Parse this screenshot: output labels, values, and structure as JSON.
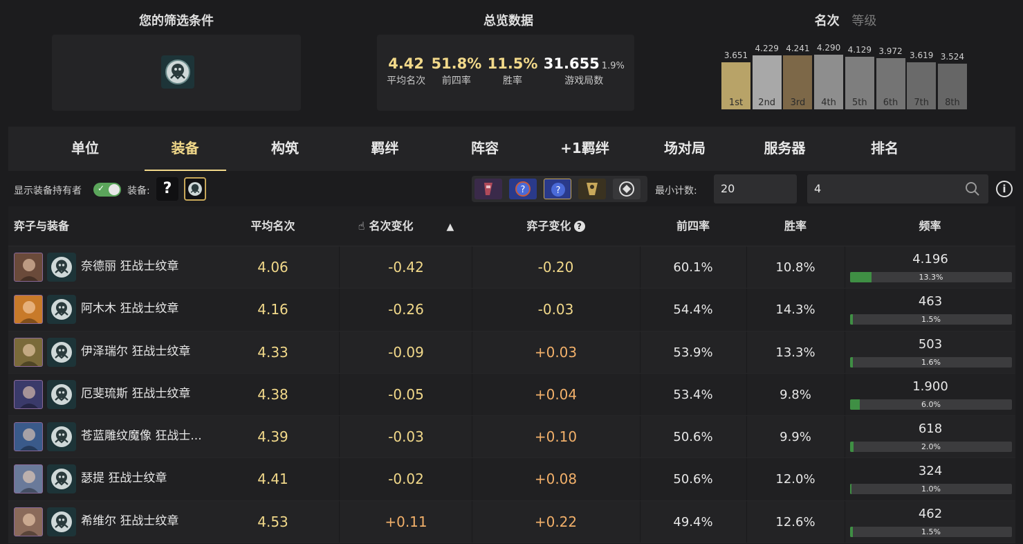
{
  "filter_panel": {
    "title": "您的筛选条件",
    "icon": "berserker-emblem-icon"
  },
  "overview": {
    "title": "总览数据",
    "stats": [
      {
        "value": "4.42",
        "sub": "",
        "label": "平均名次"
      },
      {
        "value": "51.8%",
        "sub": "",
        "label": "前四率"
      },
      {
        "value": "11.5%",
        "sub": "",
        "label": "胜率"
      },
      {
        "value": "31.655",
        "sub": "1.9%",
        "label": "游戏局数"
      }
    ]
  },
  "rank_panel": {
    "title_active": "名次",
    "title_inactive": "等级",
    "bars": [
      {
        "label": "1st",
        "value": "3.651",
        "num": 3.651,
        "color": "#b8a368"
      },
      {
        "label": "2nd",
        "value": "4.229",
        "num": 4.229,
        "color": "#a8a8a8"
      },
      {
        "label": "3rd",
        "value": "4.241",
        "num": 4.241,
        "color": "#7d6848"
      },
      {
        "label": "4th",
        "value": "4.290",
        "num": 4.29,
        "color": "#8e8e8e"
      },
      {
        "label": "5th",
        "value": "4.129",
        "num": 4.129,
        "color": "#7e7e7e"
      },
      {
        "label": "6th",
        "value": "3.972",
        "num": 3.972,
        "color": "#747474"
      },
      {
        "label": "7th",
        "value": "3.619",
        "num": 3.619,
        "color": "#6a6a6a"
      },
      {
        "label": "8th",
        "value": "3.524",
        "num": 3.524,
        "color": "#666666"
      }
    ]
  },
  "tabs": [
    "单位",
    "装备",
    "构筑",
    "羁绊",
    "阵容",
    "+1羁绊",
    "场对局",
    "服务器",
    "排名"
  ],
  "active_tab": 1,
  "filter_row": {
    "show_holder_label": "显示装备持有者",
    "equip_label": "装备:",
    "unknown_item": "?",
    "min_count_label": "最小计数:",
    "min_count_value": "20",
    "search_value": "4",
    "info": "i"
  },
  "table": {
    "headers": {
      "unit_item": "弈子与装备",
      "avg_place": "平均名次",
      "place_delta": "名次变化",
      "sort_indicator": "▲",
      "unit_delta": "弈子变化",
      "help": "?",
      "top4": "前四率",
      "win": "胜率",
      "freq": "频率"
    },
    "rows": [
      {
        "name": "奈德丽 狂战士纹章",
        "avg": "4.06",
        "delta": "-0.42",
        "unit_delta": "-0.20",
        "top4": "60.1%",
        "win": "10.8%",
        "freq": "4.196",
        "freq_pct": "13.3%",
        "freq_ratio": 0.133,
        "avatar_color": "#6a4a3a"
      },
      {
        "name": "阿木木 狂战士纹章",
        "avg": "4.16",
        "delta": "-0.26",
        "unit_delta": "-0.03",
        "top4": "54.4%",
        "win": "14.3%",
        "freq": "463",
        "freq_pct": "1.5%",
        "freq_ratio": 0.015,
        "avatar_color": "#c87a2a"
      },
      {
        "name": "伊泽瑞尔 狂战士纹章",
        "avg": "4.33",
        "delta": "-0.09",
        "unit_delta": "+0.03",
        "top4": "53.9%",
        "win": "13.3%",
        "freq": "503",
        "freq_pct": "1.6%",
        "freq_ratio": 0.016,
        "avatar_color": "#7a6a3a"
      },
      {
        "name": "厄斐琉斯 狂战士纹章",
        "avg": "4.38",
        "delta": "-0.05",
        "unit_delta": "+0.04",
        "top4": "53.4%",
        "win": "9.8%",
        "freq": "1.900",
        "freq_pct": "6.0%",
        "freq_ratio": 0.06,
        "avatar_color": "#3a3a6a"
      },
      {
        "name": "苍蓝雕纹魔像 狂战士...",
        "avg": "4.39",
        "delta": "-0.03",
        "unit_delta": "+0.10",
        "top4": "50.6%",
        "win": "9.9%",
        "freq": "618",
        "freq_pct": "2.0%",
        "freq_ratio": 0.02,
        "avatar_color": "#3a5a8a"
      },
      {
        "name": "瑟提 狂战士纹章",
        "avg": "4.41",
        "delta": "-0.02",
        "unit_delta": "+0.08",
        "top4": "50.6%",
        "win": "12.0%",
        "freq": "324",
        "freq_pct": "1.0%",
        "freq_ratio": 0.01,
        "avatar_color": "#6a7a9a"
      },
      {
        "name": "希维尔 狂战士纹章",
        "avg": "4.53",
        "delta": "+0.11",
        "unit_delta": "+0.22",
        "top4": "49.4%",
        "win": "12.6%",
        "freq": "462",
        "freq_pct": "1.5%",
        "freq_ratio": 0.015,
        "avatar_color": "#8a6a5a"
      }
    ]
  },
  "colors": {
    "accent": "#f2d98a",
    "positive": "#f2b06a",
    "bar_fill": "#3f8f44",
    "background": "#1c1c1e"
  }
}
